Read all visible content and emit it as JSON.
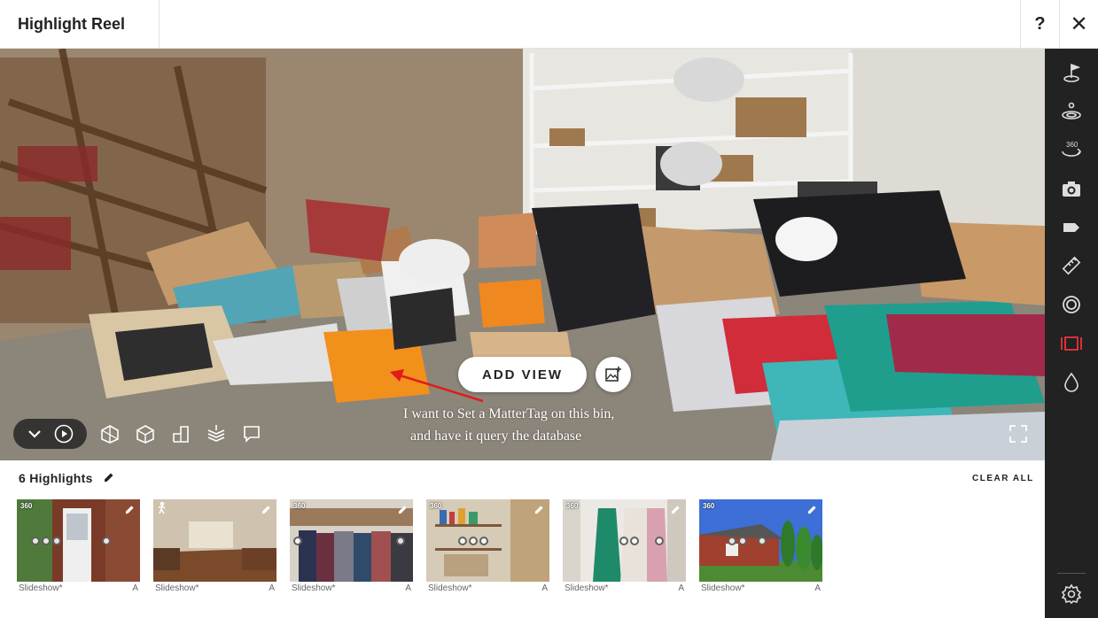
{
  "header": {
    "title": "Highlight Reel",
    "help_label": "?",
    "close_label": "✕"
  },
  "viewer": {
    "add_view_label": "ADD VIEW",
    "annotation_line1": "I want to Set a MatterTag on this bin,",
    "annotation_line2": "and have it query the database",
    "bottom_tools": [
      "dollhouse-icon",
      "floorplan-3d-icon",
      "floorplan-icon",
      "floors-icon",
      "comment-icon"
    ]
  },
  "right_toolbar": {
    "items": [
      "mattertag-icon",
      "view-icon",
      "360-view-icon",
      "camera-icon",
      "tag-icon",
      "measure-icon",
      "focus-icon",
      "highlight-reel-icon",
      "drop-icon",
      "settings-icon"
    ],
    "active": "highlight-reel-icon",
    "accent_color": "#e8343a"
  },
  "highlights": {
    "count_label": "6 Highlights",
    "clear_all_label": "CLEAR ALL",
    "items": [
      {
        "caption": "Slideshow*",
        "tag": "A",
        "badge": "360"
      },
      {
        "caption": "Slideshow*",
        "tag": "A",
        "badge": "walk"
      },
      {
        "caption": "Slideshow*",
        "tag": "A",
        "badge": "360"
      },
      {
        "caption": "Slideshow*",
        "tag": "A",
        "badge": "360"
      },
      {
        "caption": "Slideshow*",
        "tag": "A",
        "badge": "360"
      },
      {
        "caption": "Slideshow*",
        "tag": "A",
        "badge": "360"
      }
    ]
  }
}
